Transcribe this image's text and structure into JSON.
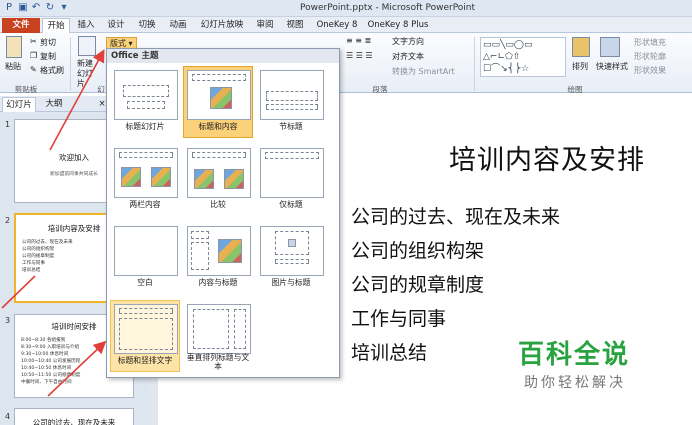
{
  "window": {
    "title": "PowerPoint.pptx - Microsoft PowerPoint"
  },
  "ribbon_tabs": [
    "文件",
    "开始",
    "插入",
    "设计",
    "切换",
    "动画",
    "幻灯片放映",
    "审阅",
    "视图",
    "OneKey 8",
    "OneKey 8 Plus"
  ],
  "clipboard": {
    "paste": "粘贴",
    "cut": "剪切",
    "copy": "复制",
    "format_painter": "格式刷",
    "group_label": "剪贴板"
  },
  "slides_group": {
    "new_slide": "新建幻灯片",
    "layout": "版式",
    "group_label": "幻"
  },
  "paragraph": {
    "text_direction": "文字方向",
    "align_text": "对齐文本",
    "convert_smartart": "转换为 SmartArt",
    "group_label": "段落"
  },
  "drawing": {
    "arrange": "排列",
    "quick_styles": "快速样式",
    "shape_fill": "形状填充",
    "shape_outline": "形状轮廓",
    "shape_effects": "形状效果",
    "group_label": "绘图"
  },
  "pane_tabs": [
    "幻灯片",
    "大纲"
  ],
  "layout_menu": {
    "header": "Office 主题",
    "layouts": [
      "标题幻灯片",
      "标题和内容",
      "节标题",
      "两栏内容",
      "比较",
      "仅标题",
      "空白",
      "内容与标题",
      "图片与标题",
      "标题和竖排文字",
      "垂直排列标题与文本"
    ]
  },
  "thumbnails": [
    {
      "num": "1",
      "title": "欢迎加入",
      "sub": "新加盟前同事共同成长",
      "lines": []
    },
    {
      "num": "2",
      "title": "培训内容及安排",
      "sub": "",
      "lines": [
        "公司的过去、现在及未来",
        "公司的组织构架",
        "公司的规章制度",
        "工作与同事",
        "培训总结"
      ]
    },
    {
      "num": "3",
      "title": "培训时间安排",
      "sub": "",
      "lines": [
        "8:00~8:30  各组报到",
        "8:30~9:00  入职培训与介绍",
        "9:30~10:00 休息时间",
        "10:00~10:40 公司发展历程",
        "10:40~10:50 休息时间",
        "10:50~11:50 公司规章制度",
        "中餐时间、下午自由时间"
      ]
    },
    {
      "num": "4",
      "title": "公司的过去、现在及未来",
      "sub": "",
      "lines": []
    }
  ],
  "slide": {
    "title": "培训内容及安排",
    "bullets": [
      "公司的过去、现在及未来",
      "公司的组织构架",
      "公司的规章制度",
      "工作与同事",
      "培训总结"
    ]
  },
  "watermark": {
    "main": "百科全说",
    "sub": "助你轻松解决"
  },
  "colors": {
    "file_tab": "#c9421f",
    "selected_layout": "#fbd27a",
    "arrow": "#e0403a",
    "watermark": "#29a340"
  }
}
